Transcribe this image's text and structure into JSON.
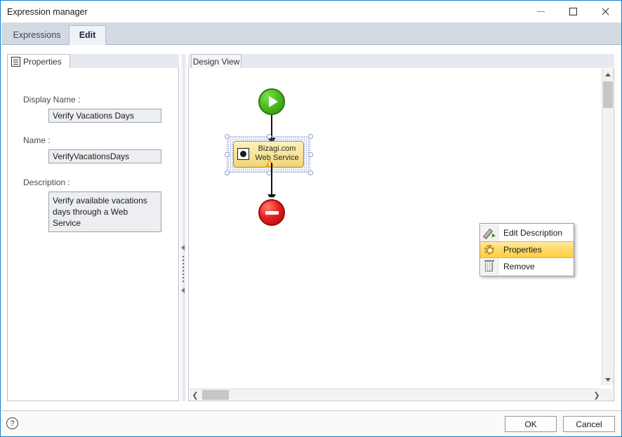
{
  "window": {
    "title": "Expression manager",
    "controls": {
      "minimize": "minimize-icon",
      "maximize": "maximize-icon",
      "close": "close-icon"
    }
  },
  "tabs": [
    {
      "label": "Expressions",
      "active": false
    },
    {
      "label": "Edit",
      "active": true
    }
  ],
  "properties_panel": {
    "tab_label": "Properties",
    "tab_icon": "document-grid-icon",
    "fields": {
      "display_name_label": "Display Name :",
      "display_name_value": "Verify Vacations Days",
      "name_label": "Name :",
      "name_value": "VerifyVacationsDays",
      "description_label": "Description :",
      "description_value": "Verify available vacations days through a Web Service"
    }
  },
  "splitter": {
    "collapse_icon": "collapse-left-arrow-icon",
    "grip_icon": "grip-dots-icon"
  },
  "design_view": {
    "tab_label": "Design View",
    "nodes": {
      "start": {
        "name": "start-event",
        "icon": "play-icon",
        "color": "#4cbb22"
      },
      "task": {
        "name": "web-service-task",
        "line1": "Bizagi.com",
        "line2": "Web Service",
        "icon": "web-service-icon",
        "warning_icon": "warning-triangle-icon",
        "fill": "#f8e59a",
        "border": "#b08b2a",
        "selected": true
      },
      "end": {
        "name": "end-event",
        "icon": "stop-icon",
        "color": "#e81c1c"
      }
    },
    "scrollbars": {
      "v_up": "scroll-up-arrow-icon",
      "v_down": "scroll-down-arrow-icon",
      "h_left": "❮",
      "h_right": "❯"
    }
  },
  "context_menu": {
    "items": [
      {
        "label": "Edit Description",
        "icon": "pencil-icon",
        "selected": false
      },
      {
        "label": "Properties",
        "icon": "gear-icon",
        "selected": true
      },
      {
        "label": "Remove",
        "icon": "trash-icon",
        "selected": false
      }
    ],
    "highlight_color": "#ffd965"
  },
  "footer": {
    "help_icon": "?",
    "ok_label": "OK",
    "cancel_label": "Cancel"
  }
}
